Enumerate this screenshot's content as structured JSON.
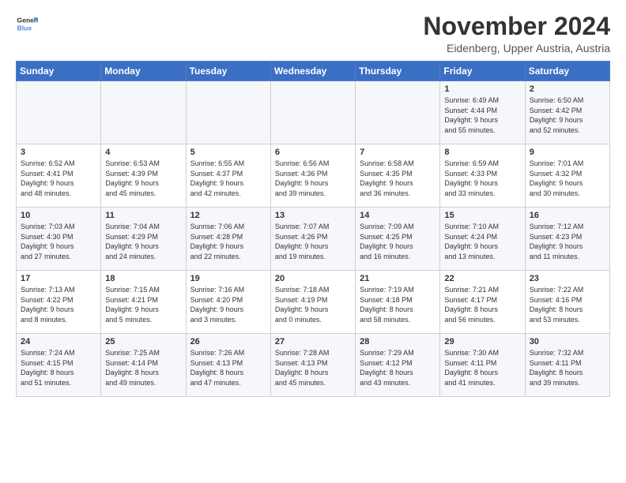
{
  "logo": {
    "line1": "General",
    "line2": "Blue"
  },
  "title": "November 2024",
  "location": "Eidenberg, Upper Austria, Austria",
  "days_header": [
    "Sunday",
    "Monday",
    "Tuesday",
    "Wednesday",
    "Thursday",
    "Friday",
    "Saturday"
  ],
  "weeks": [
    [
      {
        "day": "",
        "info": ""
      },
      {
        "day": "",
        "info": ""
      },
      {
        "day": "",
        "info": ""
      },
      {
        "day": "",
        "info": ""
      },
      {
        "day": "",
        "info": ""
      },
      {
        "day": "1",
        "info": "Sunrise: 6:49 AM\nSunset: 4:44 PM\nDaylight: 9 hours\nand 55 minutes."
      },
      {
        "day": "2",
        "info": "Sunrise: 6:50 AM\nSunset: 4:42 PM\nDaylight: 9 hours\nand 52 minutes."
      }
    ],
    [
      {
        "day": "3",
        "info": "Sunrise: 6:52 AM\nSunset: 4:41 PM\nDaylight: 9 hours\nand 48 minutes."
      },
      {
        "day": "4",
        "info": "Sunrise: 6:53 AM\nSunset: 4:39 PM\nDaylight: 9 hours\nand 45 minutes."
      },
      {
        "day": "5",
        "info": "Sunrise: 6:55 AM\nSunset: 4:37 PM\nDaylight: 9 hours\nand 42 minutes."
      },
      {
        "day": "6",
        "info": "Sunrise: 6:56 AM\nSunset: 4:36 PM\nDaylight: 9 hours\nand 39 minutes."
      },
      {
        "day": "7",
        "info": "Sunrise: 6:58 AM\nSunset: 4:35 PM\nDaylight: 9 hours\nand 36 minutes."
      },
      {
        "day": "8",
        "info": "Sunrise: 6:59 AM\nSunset: 4:33 PM\nDaylight: 9 hours\nand 33 minutes."
      },
      {
        "day": "9",
        "info": "Sunrise: 7:01 AM\nSunset: 4:32 PM\nDaylight: 9 hours\nand 30 minutes."
      }
    ],
    [
      {
        "day": "10",
        "info": "Sunrise: 7:03 AM\nSunset: 4:30 PM\nDaylight: 9 hours\nand 27 minutes."
      },
      {
        "day": "11",
        "info": "Sunrise: 7:04 AM\nSunset: 4:29 PM\nDaylight: 9 hours\nand 24 minutes."
      },
      {
        "day": "12",
        "info": "Sunrise: 7:06 AM\nSunset: 4:28 PM\nDaylight: 9 hours\nand 22 minutes."
      },
      {
        "day": "13",
        "info": "Sunrise: 7:07 AM\nSunset: 4:26 PM\nDaylight: 9 hours\nand 19 minutes."
      },
      {
        "day": "14",
        "info": "Sunrise: 7:09 AM\nSunset: 4:25 PM\nDaylight: 9 hours\nand 16 minutes."
      },
      {
        "day": "15",
        "info": "Sunrise: 7:10 AM\nSunset: 4:24 PM\nDaylight: 9 hours\nand 13 minutes."
      },
      {
        "day": "16",
        "info": "Sunrise: 7:12 AM\nSunset: 4:23 PM\nDaylight: 9 hours\nand 11 minutes."
      }
    ],
    [
      {
        "day": "17",
        "info": "Sunrise: 7:13 AM\nSunset: 4:22 PM\nDaylight: 9 hours\nand 8 minutes."
      },
      {
        "day": "18",
        "info": "Sunrise: 7:15 AM\nSunset: 4:21 PM\nDaylight: 9 hours\nand 5 minutes."
      },
      {
        "day": "19",
        "info": "Sunrise: 7:16 AM\nSunset: 4:20 PM\nDaylight: 9 hours\nand 3 minutes."
      },
      {
        "day": "20",
        "info": "Sunrise: 7:18 AM\nSunset: 4:19 PM\nDaylight: 9 hours\nand 0 minutes."
      },
      {
        "day": "21",
        "info": "Sunrise: 7:19 AM\nSunset: 4:18 PM\nDaylight: 8 hours\nand 58 minutes."
      },
      {
        "day": "22",
        "info": "Sunrise: 7:21 AM\nSunset: 4:17 PM\nDaylight: 8 hours\nand 56 minutes."
      },
      {
        "day": "23",
        "info": "Sunrise: 7:22 AM\nSunset: 4:16 PM\nDaylight: 8 hours\nand 53 minutes."
      }
    ],
    [
      {
        "day": "24",
        "info": "Sunrise: 7:24 AM\nSunset: 4:15 PM\nDaylight: 8 hours\nand 51 minutes."
      },
      {
        "day": "25",
        "info": "Sunrise: 7:25 AM\nSunset: 4:14 PM\nDaylight: 8 hours\nand 49 minutes."
      },
      {
        "day": "26",
        "info": "Sunrise: 7:26 AM\nSunset: 4:13 PM\nDaylight: 8 hours\nand 47 minutes."
      },
      {
        "day": "27",
        "info": "Sunrise: 7:28 AM\nSunset: 4:13 PM\nDaylight: 8 hours\nand 45 minutes."
      },
      {
        "day": "28",
        "info": "Sunrise: 7:29 AM\nSunset: 4:12 PM\nDaylight: 8 hours\nand 43 minutes."
      },
      {
        "day": "29",
        "info": "Sunrise: 7:30 AM\nSunset: 4:11 PM\nDaylight: 8 hours\nand 41 minutes."
      },
      {
        "day": "30",
        "info": "Sunrise: 7:32 AM\nSunset: 4:11 PM\nDaylight: 8 hours\nand 39 minutes."
      }
    ]
  ]
}
